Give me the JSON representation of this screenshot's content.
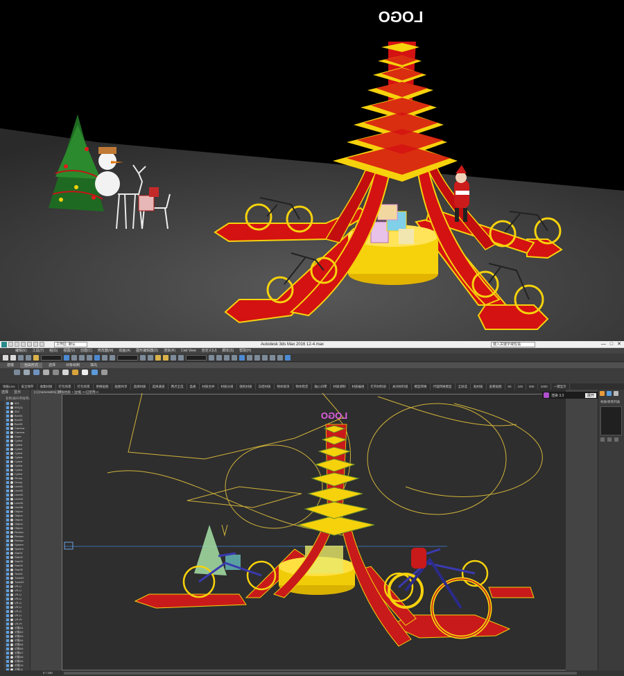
{
  "render": {
    "logo_text": "LOGO",
    "colors": {
      "red": "#d41212",
      "yellow": "#f6d20c",
      "floor": "#3d3d3d",
      "sky": "#000000"
    }
  },
  "max": {
    "titlebar": {
      "workspace": "工作区: 默认",
      "title": "Autodesk 3ds Max 2016    12-4.max",
      "search_placeholder": "键入关键字或短语",
      "minimize": "—",
      "maximize": "□",
      "close": "✕"
    },
    "menus": [
      "编辑(E)",
      "工具(T)",
      "组(G)",
      "视图(V)",
      "创建(C)",
      "修改器(M)",
      "动画(A)",
      "图形编辑器(D)",
      "渲染(R)",
      "Civil View",
      "自定义(U)",
      "脚本(S)",
      "帮助(H)"
    ],
    "toolbar": {
      "selection_filter": "全部",
      "view_dropdown": "视图"
    },
    "ribbon_tabs": [
      "建模",
      "自由形式",
      "选择",
      "对象绘制",
      "填充"
    ],
    "plugin_buttons": [
      "地板Lino",
      "安全保存",
      "收集材质",
      "打包场景",
      "打包场景",
      "更换贴图",
      "贴图共享",
      "选择材质",
      "选择通道",
      "两点全选",
      "晶格",
      "材质合并",
      "材质分组",
      "随机材质",
      "冻结材质",
      "物体取消",
      "物体稳定",
      "轴心归零",
      "材质调制",
      "材质编组",
      "打开材料组",
      "关闭材料组",
      "模型转换",
      "代理转换模型",
      "全屏选",
      "贴材质",
      "查看贴图",
      "50",
      "100",
      "500",
      "1000",
      "一键显示"
    ],
    "scene_explorer": {
      "header_select": "选择",
      "header_display": "显示",
      "column_name": "名称(按升序排序)",
      "items": [
        "001",
        "001(1)",
        "002",
        "Box04",
        "Box25",
        "Box26",
        "Camera",
        "Camera",
        "Cone",
        "Cylind",
        "Cylind",
        "Cylind",
        "Cylind",
        "Cylind",
        "Cylind",
        "Cylind",
        "Cylind",
        "Cylind",
        "Group",
        "Group",
        "Line01",
        "Line02",
        "Line03",
        "Line04",
        "Line05",
        "Line06",
        "Object",
        "Object",
        "Object",
        "Object",
        "Object",
        "Rectan",
        "Rectan",
        "Rectan",
        "Sphere",
        "Sphere",
        "Star01",
        "Star02",
        "Star03",
        "Star04",
        "Star05",
        "Text01",
        "Tube01",
        "Tube02",
        "VR-Li",
        "VR-Li",
        "VR-Li",
        "VR-Li",
        "VR-Li",
        "VR-Li",
        "VR-Li",
        "VR-Li",
        "VR-Pr",
        "VR-Pr",
        "对象01",
        "对象02",
        "对象03",
        "对象04",
        "对象05",
        "对象06",
        "对象07",
        "对象08",
        "对象09",
        "对象10",
        "对象11",
        "对象12"
      ]
    },
    "viewport": {
      "label": "[+] [Camera001] [模拟材质 + 边线] <<已禁用>>",
      "logo_text": "LOGO"
    },
    "plugin_badge": {
      "name": "渲染 3.3",
      "button": "展开"
    },
    "command_panel": {
      "label": "材质/修改列表"
    },
    "statusbar": {
      "frame": "0 / 100"
    }
  }
}
